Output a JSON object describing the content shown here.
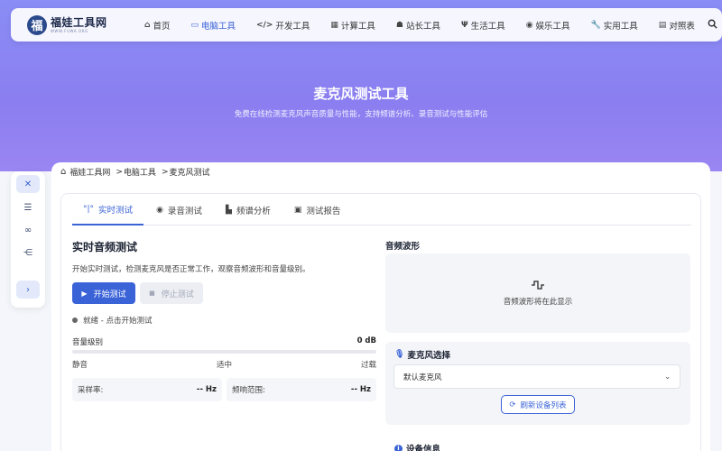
{
  "brand": {
    "logo_char": "福",
    "name": "福娃工具网",
    "sub": "WWW.FUWA.ORG"
  },
  "nav": [
    {
      "icon": "home-icon",
      "glyph": "⌂",
      "label": "首页",
      "active": false
    },
    {
      "icon": "monitor-icon",
      "glyph": "▭",
      "label": "电脑工具",
      "active": true
    },
    {
      "icon": "code-icon",
      "glyph": "</>",
      "label": "开发工具",
      "active": false
    },
    {
      "icon": "calculator-icon",
      "glyph": "▦",
      "label": "计算工具",
      "active": false
    },
    {
      "icon": "webmaster-icon",
      "glyph": "☗",
      "label": "站长工具",
      "active": false
    },
    {
      "icon": "utensils-icon",
      "glyph": "Ψ",
      "label": "生活工具",
      "active": false
    },
    {
      "icon": "gamepad-icon",
      "glyph": "◉",
      "label": "娱乐工具",
      "active": false
    },
    {
      "icon": "wrench-icon",
      "glyph": "🔧",
      "label": "实用工具",
      "active": false
    },
    {
      "icon": "table-icon",
      "glyph": "▤",
      "label": "对照表",
      "active": false
    }
  ],
  "hero": {
    "title": "麦克风测试工具",
    "subtitle": "免费在线检测麦克风声音质量与性能，支持频谱分析、录音测试与性能评估"
  },
  "breadcrumb": {
    "home": "福娃工具网",
    "cat": "电脑工具",
    "current": "麦克风测试"
  },
  "tabs": [
    {
      "icon": "microphone-wave-icon",
      "glyph": "°|°",
      "label": "实时测试",
      "active": true
    },
    {
      "icon": "record-icon",
      "glyph": "◉",
      "label": "录音测试",
      "active": false
    },
    {
      "icon": "chart-icon",
      "glyph": "▙",
      "label": "频谱分析",
      "active": false
    },
    {
      "icon": "clipboard-icon",
      "glyph": "▣",
      "label": "测试报告",
      "active": false
    }
  ],
  "realtime": {
    "title": "实时音频测试",
    "desc": "开始实时测试，检测麦克风是否正常工作，观察音频波形和音量级别。",
    "start_label": "开始测试",
    "stop_label": "停止测试",
    "status": "就绪 - 点击开始测试",
    "level_label": "音量级别",
    "level_value": "0 dB",
    "level_fraction": 0,
    "scale": [
      "静音",
      "适中",
      "过载"
    ],
    "sample_rate_label": "采样率:",
    "sample_rate_value": "-- Hz",
    "freq_range_label": "频响范围:",
    "freq_range_value": "-- Hz"
  },
  "waveform": {
    "title": "音频波形",
    "placeholder": "音频波形将在此显示"
  },
  "mic": {
    "title": "麦克风选择",
    "selected": "默认麦克风",
    "refresh_label": "刷新设备列表"
  },
  "device": {
    "title": "设备信息"
  },
  "colors": {
    "accent": "#3b63d8",
    "hero": "#8a8df5"
  }
}
